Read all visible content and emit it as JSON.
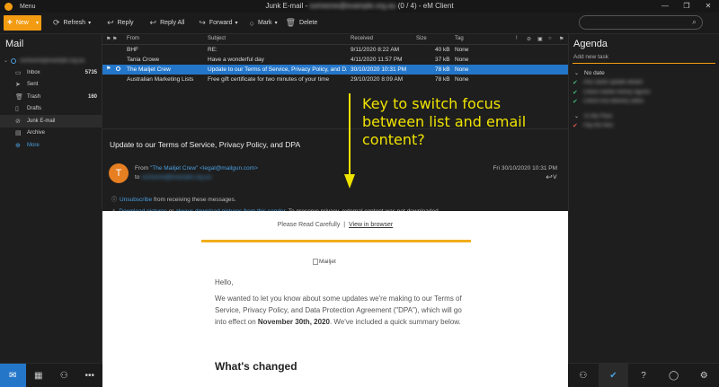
{
  "titlebar": {
    "menu_label": "Menu",
    "title_prefix": "Junk E-mail - ",
    "title_account": "someone@example.org.au",
    "title_suffix": " (0 / 4) - eM Client",
    "minimize": "—",
    "restore": "❐",
    "close": "✕"
  },
  "toolbar": {
    "new_label": "New",
    "refresh_label": "Refresh",
    "reply_label": "Reply",
    "reply_all_label": "Reply All",
    "forward_label": "Forward",
    "mark_label": "Mark",
    "delete_label": "Delete",
    "search_placeholder": ""
  },
  "sidebar": {
    "title": "Mail",
    "account": "someone@example.org.au",
    "folders": [
      {
        "label": "Inbox",
        "count": "5735",
        "icon": "inbox-icon"
      },
      {
        "label": "Sent",
        "count": "",
        "icon": "sent-icon"
      },
      {
        "label": "Trash",
        "count": "160",
        "icon": "trash-icon"
      },
      {
        "label": "Drafts",
        "count": "",
        "icon": "drafts-icon"
      },
      {
        "label": "Junk E-mail",
        "count": "",
        "icon": "junk-icon"
      },
      {
        "label": "Archive",
        "count": "",
        "icon": "archive-icon"
      },
      {
        "label": "More",
        "count": "",
        "icon": "more-icon"
      }
    ]
  },
  "list": {
    "headers": {
      "from": "From",
      "subject": "Subject",
      "received": "Received",
      "size": "Size",
      "tag": "Tag"
    },
    "rows": [
      {
        "from": "BHF",
        "subject": "RE:",
        "received": "9/11/2020 8:22 AM",
        "size": "40 kB",
        "tag": "None"
      },
      {
        "from": "Tania Crowe",
        "subject": "Have a wonderful day",
        "received": "4/11/2020 11:57 PM",
        "size": "37 kB",
        "tag": "None"
      },
      {
        "from": "The Mailjet Crew",
        "subject": "Update to our Terms of Service, Privacy Policy, and D...",
        "received": "30/10/2020 10:31 PM",
        "size": "78 kB",
        "tag": "None"
      },
      {
        "from": "Australian Marketing Lists",
        "subject": "Free gift certificate for two minutes of your time",
        "received": "29/10/2020 8:09 AM",
        "size": "78 kB",
        "tag": "None"
      }
    ]
  },
  "email": {
    "subject": "Update to our Terms of Service, Privacy Policy, and DPA",
    "avatar_letter": "T",
    "from_prefix": "From ",
    "from_name": "\"The Mailjet Crew\" <legal@mailgun.com>",
    "to_prefix": "to ",
    "to_address": "someone@example.org.au",
    "date": "Fri 30/10/2020 10:31 PM",
    "unsubscribe_link": "Unsubscribe",
    "unsubscribe_rest": " from receiving these messages.",
    "download_link": "Download pictures",
    "download_or": " or ",
    "always_link": "always download pictures from this sender",
    "privacy_note": ". To preserve privacy, external content was not downloaded.",
    "body": {
      "please_read": "Please Read Carefully",
      "separator": "|",
      "view_browser": "View in browser",
      "logo_alt": "Mailjet",
      "hello": "Hello,",
      "para1_a": "We wanted to let you know about some updates we're making to our Terms of Service, Privacy Policy, and Data Protection Agreement (\"DPA\"), which will go into effect on ",
      "para1_date": "November 30th, 2020",
      "para1_b": ". We've included a quick summary below.",
      "heading": "What's changed"
    }
  },
  "annotation": {
    "text": "Key to switch focus between list and email content?"
  },
  "agenda": {
    "title": "Agenda",
    "add_task_placeholder": "Add new task",
    "section_no_date": "No date",
    "section_past": "In the Past",
    "tasks_no_date": [
      "ANZ Bank update details",
      "Check Adobe history figures",
      "Check fruit delivery dates"
    ],
    "tasks_past": [
      "Pay the fees"
    ]
  },
  "colors": {
    "accent": "#f39c12",
    "selection": "#2476c9",
    "link": "#4a9fe0",
    "annotation": "#f0e300"
  }
}
